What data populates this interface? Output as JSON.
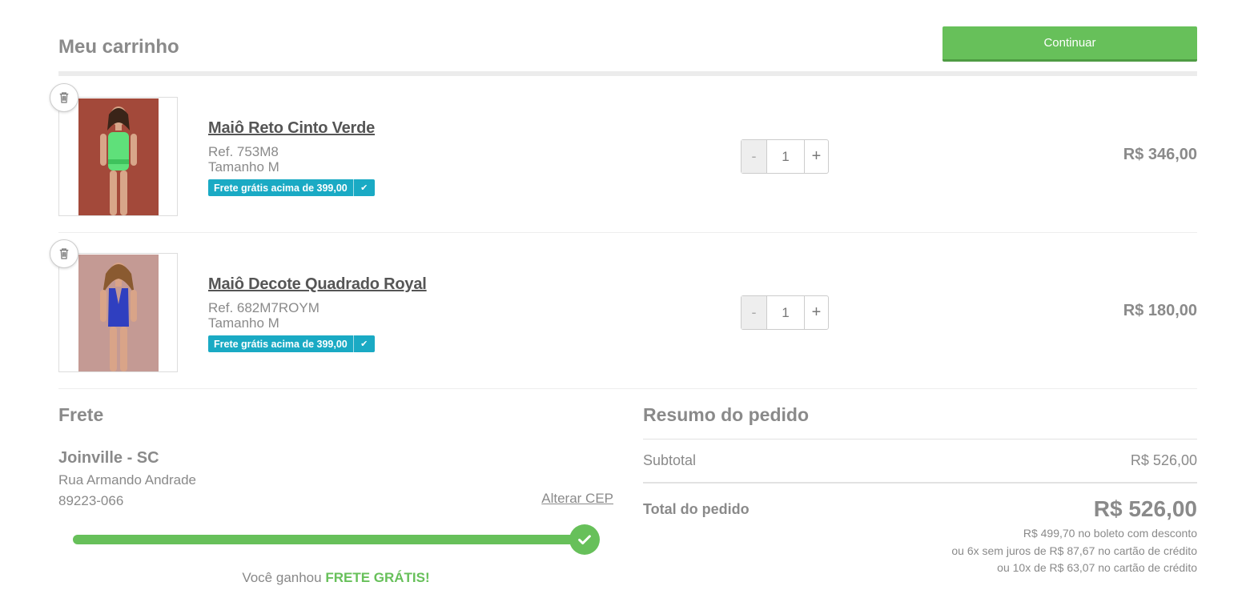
{
  "header": {
    "title": "Meu carrinho",
    "continue_label": "Continuar"
  },
  "items": [
    {
      "name": "Maiô Reto Cinto Verde",
      "ref": "Ref. 753M8",
      "size": "Tamanho M",
      "badge": "Frete grátis acima de 399,00",
      "quantity": "1",
      "price": "R$ 346,00",
      "swimsuit_color": "#5fe07a",
      "background_color": "#a3493a"
    },
    {
      "name": "Maiô Decote Quadrado Royal",
      "ref": "Ref. 682M7ROYM",
      "size": "Tamanho M",
      "badge": "Frete grátis acima de 399,00",
      "quantity": "1",
      "price": "R$ 180,00",
      "swimsuit_color": "#2f3fc0",
      "background_color": "#c49a94"
    }
  ],
  "qty_controls": {
    "minus": "-",
    "plus": "+"
  },
  "shipping": {
    "title": "Frete",
    "city": "Joinville - SC",
    "street": "Rua Armando Andrade",
    "cep": "89223-066",
    "change_cep": "Alterar CEP",
    "progress_fraction": 1.0,
    "won_prefix": "Você ganhou",
    "won_highlight": "FRETE GRÁTIS!"
  },
  "summary": {
    "title": "Resumo do pedido",
    "subtotal_label": "Subtotal",
    "subtotal_value": "R$ 526,00",
    "total_label": "Total do pedido",
    "total_value": "R$ 526,00",
    "installments": [
      "R$ 499,70 no boleto com desconto",
      "ou 6x sem juros de R$ 87,67 no cartão de crédito",
      "ou 10x de R$ 63,07 no cartão de crédito"
    ]
  },
  "colors": {
    "accent_green": "#67c05a",
    "badge_blue": "#1aaac4"
  }
}
